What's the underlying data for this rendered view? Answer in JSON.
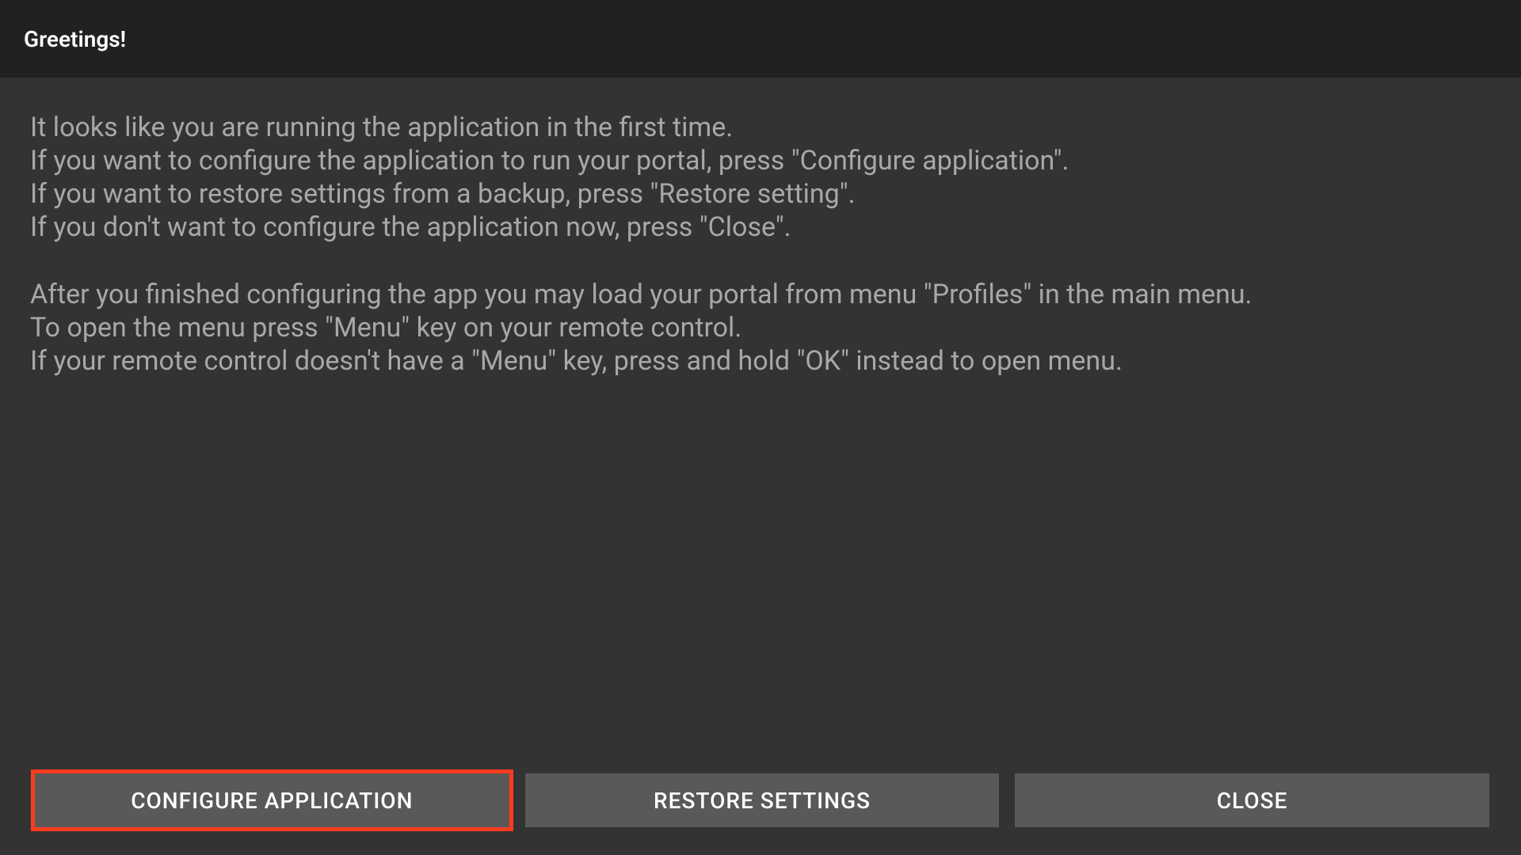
{
  "header": {
    "title": "Greetings!"
  },
  "message": {
    "line1": "It looks like you are running the application in the first time.",
    "line2": " If you want to configure the application to run your portal, press \"Configure application\".",
    "line3": " If you want to restore settings from a backup, press \"Restore setting\".",
    "line4": " If you don't want to configure the application now, press \"Close\".",
    "line5": "",
    "line6": " After you finished configuring the app you may load your portal from menu \"Profiles\" in the main menu.",
    "line7": " To open the menu press \"Menu\" key on your remote control.",
    "line8": " If your remote control doesn't have a \"Menu\" key, press and hold \"OK\" instead to open menu."
  },
  "buttons": {
    "configure_label": "CONFIGURE APPLICATION",
    "restore_label": "RESTORE SETTINGS",
    "close_label": "CLOSE"
  }
}
